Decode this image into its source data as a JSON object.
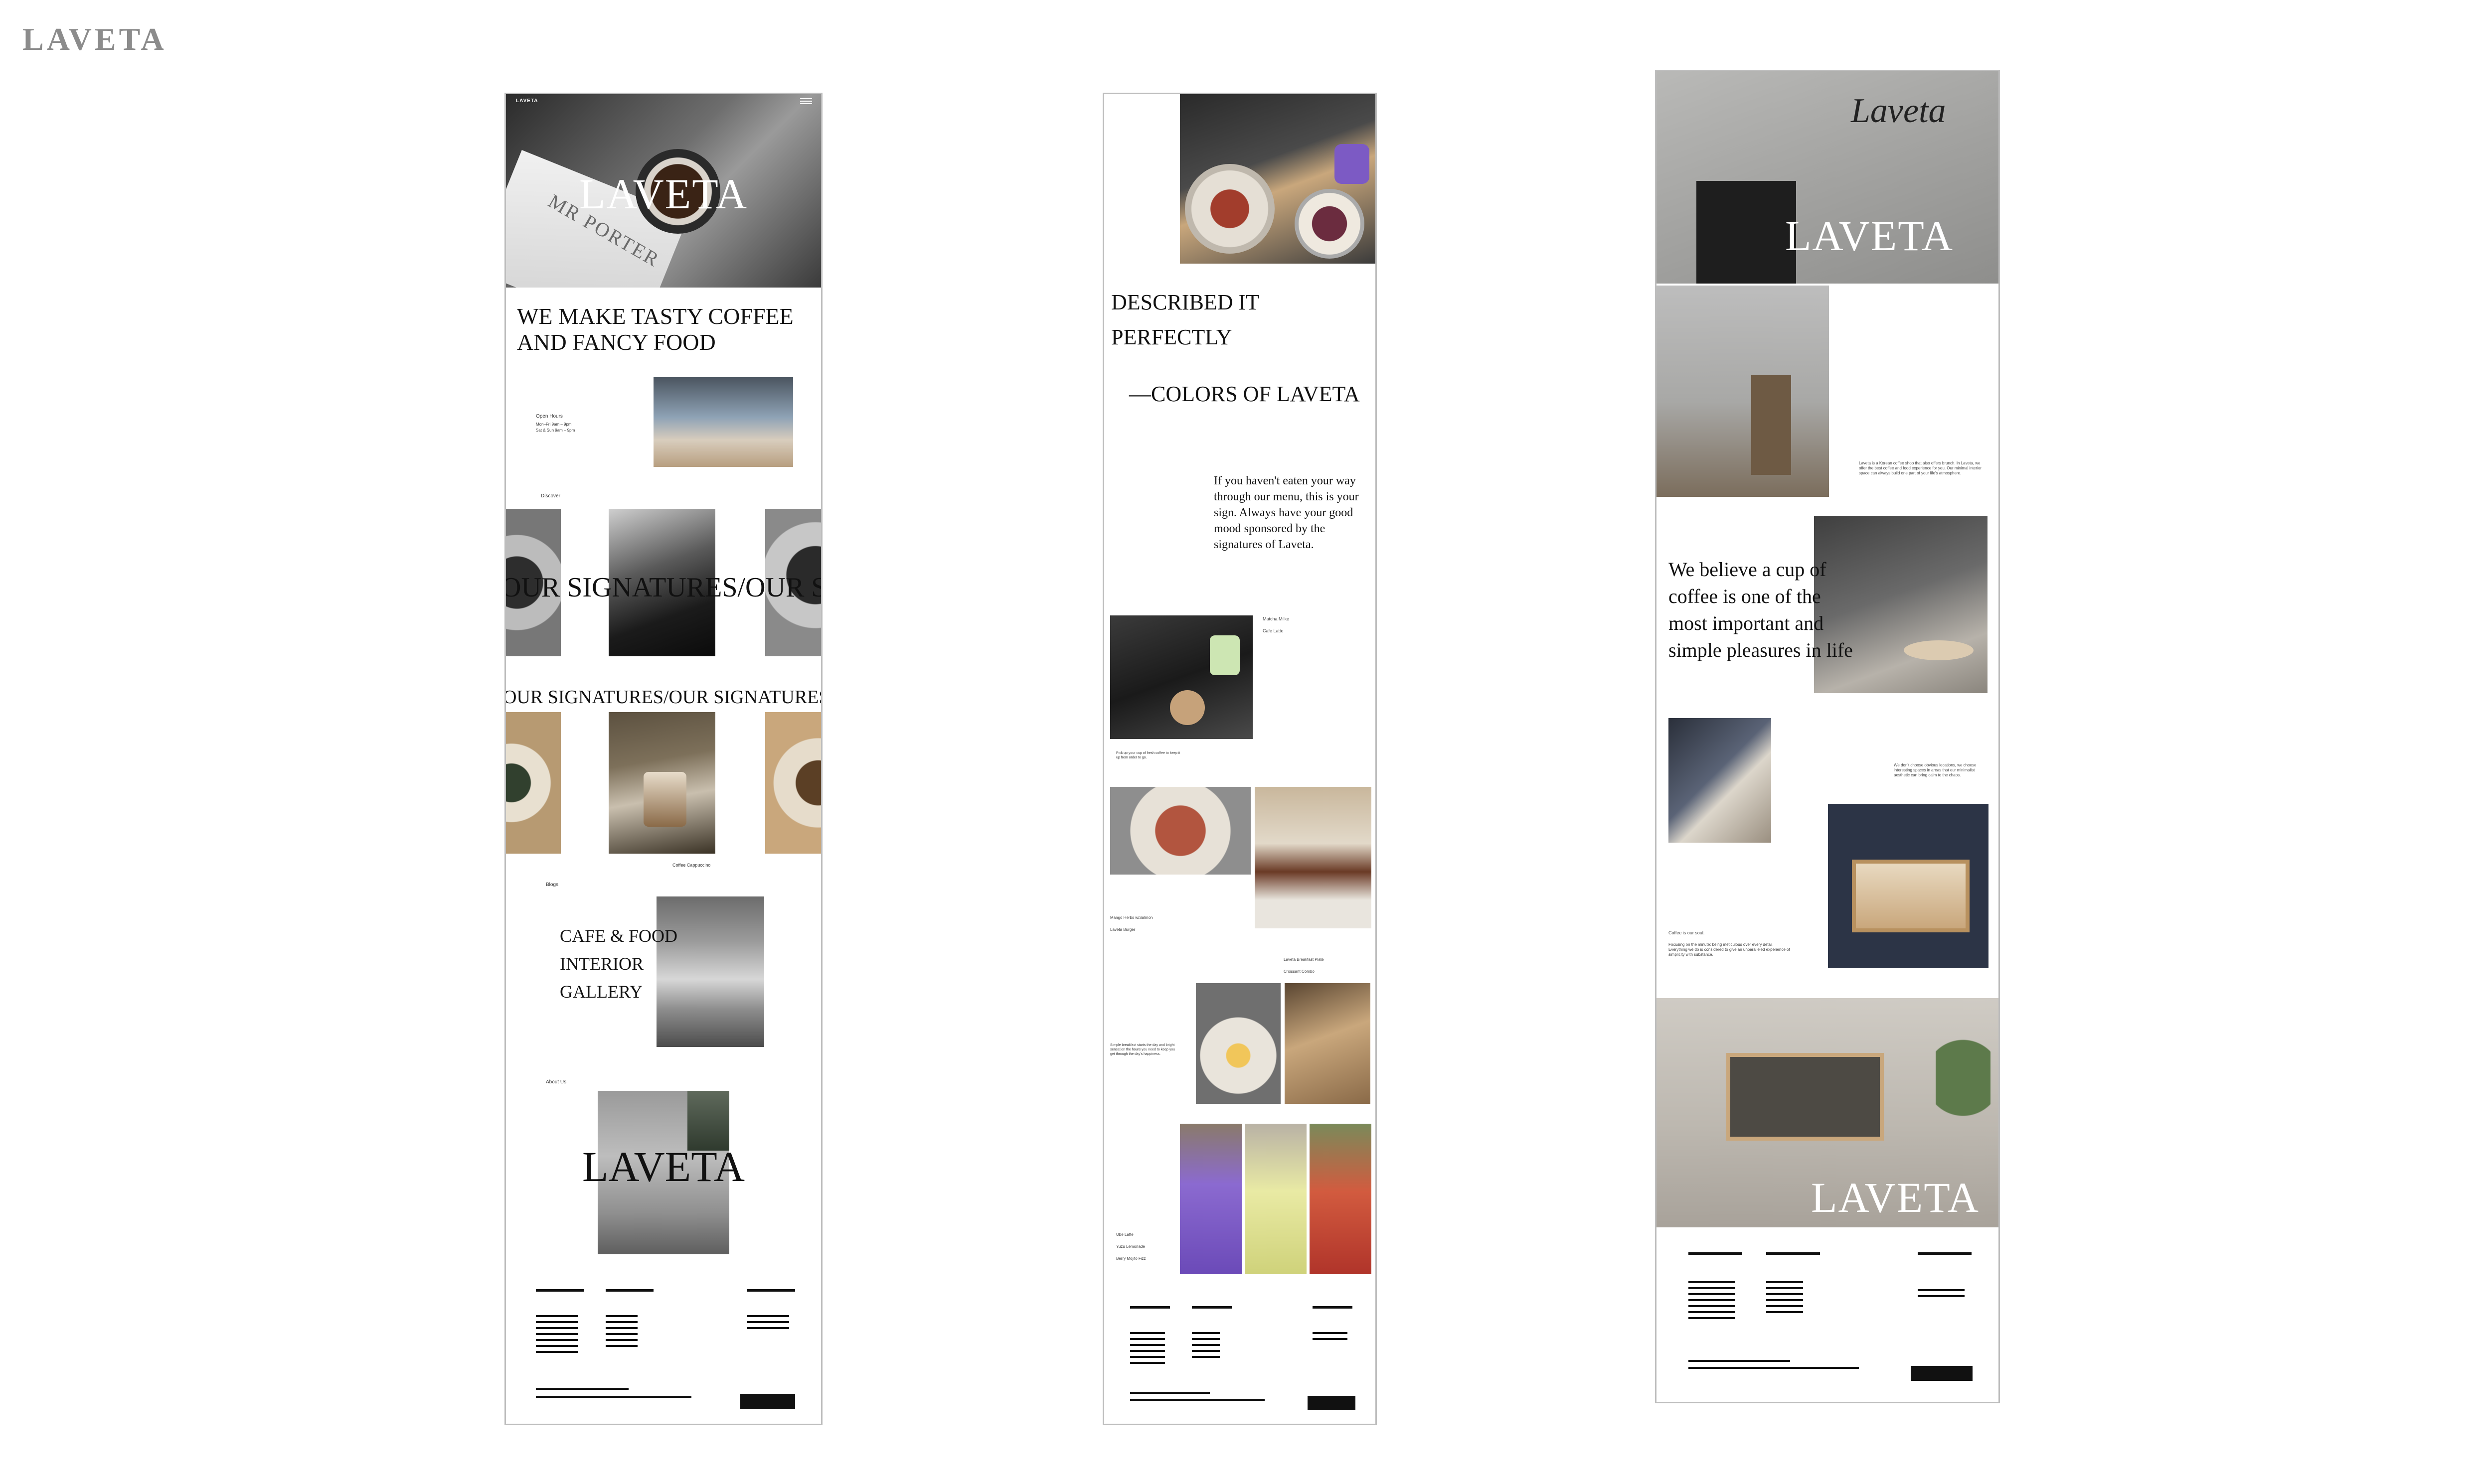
{
  "brand": {
    "mark": "LAVETA"
  },
  "mobile_page": {
    "top_logo": "LAVETA",
    "hero_title": "LAVETA",
    "hero_book_text": "MR PORTER",
    "headline": "WE MAKE TASTY COFFEE AND FANCY FOOD",
    "open_hours_label": "Open Hours",
    "open_hours_lines": [
      "Mon–Fri   9am – 9pm",
      "Sat & Sun  9am – 9pm"
    ],
    "discover_label": "Discover",
    "marquee_text": "OUR SIGNATURES/OUR SIGNATURES/OUR SIGNATURES",
    "marquee_text_2": "OUR SIGNATURES/OUR SIGNATURES/OUR SIGNATURES",
    "caption_coffee": "Coffee Cappuccino",
    "blogs_label": "Blogs",
    "gallery_title_lines": [
      "CAFE & FOOD",
      "INTERIOR",
      "GALLERY"
    ],
    "about_label": "About Us",
    "about_title": "LAVETA"
  },
  "menu_page": {
    "headline_lines": [
      "DESCRIBED IT",
      "PERFECTLY"
    ],
    "subhead": "—COLORS OF LAVETA",
    "intro": "If you haven't eaten your way through our menu, this is your sign. Always have your good mood sponsored by the signatures of Laveta.",
    "matcha_names": [
      "Matcha Milke",
      "Cafe Latte"
    ],
    "matcha_caption": "Pick up your cup of fresh coffee to keep it up from order to go.",
    "food_names": [
      "Mango Herbs w/Salmon",
      "Laveta Burger"
    ],
    "breakfast_names": [
      "Laveta Breakfast Plate",
      "Croissant Combo"
    ],
    "breakfast_caption": "Simple breakfast starts the day and bright sensation the hours you need to keep you get through the day's happiness.",
    "drink_names": [
      "Ube Latte",
      "Yuzu Lemonade",
      "Berry Mojito Fizz"
    ]
  },
  "about_page": {
    "hero_title": "LAVETA",
    "signage": "Laveta",
    "intro": "Laveta is a Korean coffee shop that also offers brunch. In Laveta, we offer the best coffee and food experience for you. Our minimal interior space can always build one part of your life's atmosphere.",
    "belief_lines": [
      "We believe a cup of",
      "coffee is one of the",
      "most important and",
      "simple pleasures in life"
    ],
    "locations_text": "We don't choose obvious locations, we choose interesting spaces in areas that our minimalist aesthetic can bring calm to the chaos.",
    "soul_title": "Coffee is our soul.",
    "soul_text": "Focusing on the minute: being meticulous over every detail. Everything we do is considered to give an unparalleled experience of simplicity with substance.",
    "footer_title": "LAVETA"
  },
  "colors": {
    "ink": "#111111",
    "frame_border": "#bdbdbd",
    "brand_grey": "#8c8c8c",
    "concrete": "#a9a9a7",
    "wood": "#c9a77c",
    "navy_wall": "#2c3446"
  }
}
